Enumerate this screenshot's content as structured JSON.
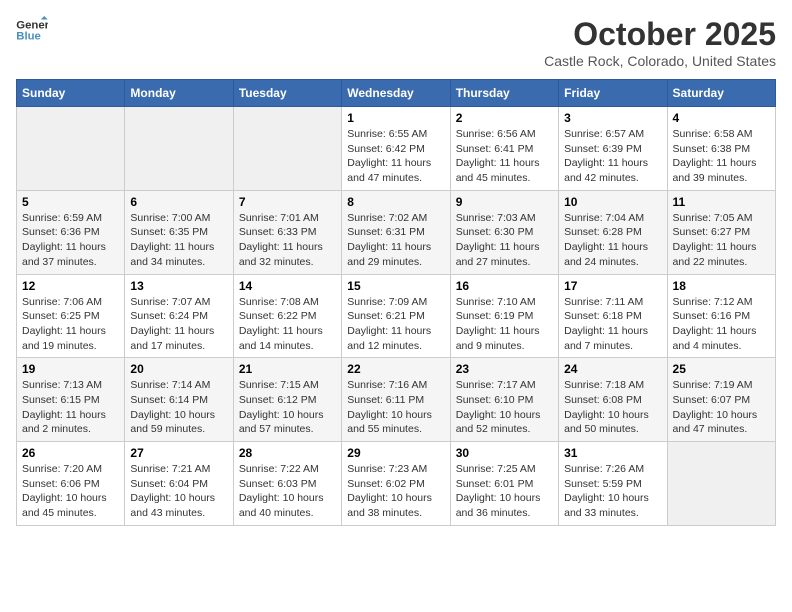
{
  "header": {
    "logo_line1": "General",
    "logo_line2": "Blue",
    "month": "October 2025",
    "location": "Castle Rock, Colorado, United States"
  },
  "weekdays": [
    "Sunday",
    "Monday",
    "Tuesday",
    "Wednesday",
    "Thursday",
    "Friday",
    "Saturday"
  ],
  "weeks": [
    [
      {
        "num": "",
        "info": ""
      },
      {
        "num": "",
        "info": ""
      },
      {
        "num": "",
        "info": ""
      },
      {
        "num": "1",
        "info": "Sunrise: 6:55 AM\nSunset: 6:42 PM\nDaylight: 11 hours and 47 minutes."
      },
      {
        "num": "2",
        "info": "Sunrise: 6:56 AM\nSunset: 6:41 PM\nDaylight: 11 hours and 45 minutes."
      },
      {
        "num": "3",
        "info": "Sunrise: 6:57 AM\nSunset: 6:39 PM\nDaylight: 11 hours and 42 minutes."
      },
      {
        "num": "4",
        "info": "Sunrise: 6:58 AM\nSunset: 6:38 PM\nDaylight: 11 hours and 39 minutes."
      }
    ],
    [
      {
        "num": "5",
        "info": "Sunrise: 6:59 AM\nSunset: 6:36 PM\nDaylight: 11 hours and 37 minutes."
      },
      {
        "num": "6",
        "info": "Sunrise: 7:00 AM\nSunset: 6:35 PM\nDaylight: 11 hours and 34 minutes."
      },
      {
        "num": "7",
        "info": "Sunrise: 7:01 AM\nSunset: 6:33 PM\nDaylight: 11 hours and 32 minutes."
      },
      {
        "num": "8",
        "info": "Sunrise: 7:02 AM\nSunset: 6:31 PM\nDaylight: 11 hours and 29 minutes."
      },
      {
        "num": "9",
        "info": "Sunrise: 7:03 AM\nSunset: 6:30 PM\nDaylight: 11 hours and 27 minutes."
      },
      {
        "num": "10",
        "info": "Sunrise: 7:04 AM\nSunset: 6:28 PM\nDaylight: 11 hours and 24 minutes."
      },
      {
        "num": "11",
        "info": "Sunrise: 7:05 AM\nSunset: 6:27 PM\nDaylight: 11 hours and 22 minutes."
      }
    ],
    [
      {
        "num": "12",
        "info": "Sunrise: 7:06 AM\nSunset: 6:25 PM\nDaylight: 11 hours and 19 minutes."
      },
      {
        "num": "13",
        "info": "Sunrise: 7:07 AM\nSunset: 6:24 PM\nDaylight: 11 hours and 17 minutes."
      },
      {
        "num": "14",
        "info": "Sunrise: 7:08 AM\nSunset: 6:22 PM\nDaylight: 11 hours and 14 minutes."
      },
      {
        "num": "15",
        "info": "Sunrise: 7:09 AM\nSunset: 6:21 PM\nDaylight: 11 hours and 12 minutes."
      },
      {
        "num": "16",
        "info": "Sunrise: 7:10 AM\nSunset: 6:19 PM\nDaylight: 11 hours and 9 minutes."
      },
      {
        "num": "17",
        "info": "Sunrise: 7:11 AM\nSunset: 6:18 PM\nDaylight: 11 hours and 7 minutes."
      },
      {
        "num": "18",
        "info": "Sunrise: 7:12 AM\nSunset: 6:16 PM\nDaylight: 11 hours and 4 minutes."
      }
    ],
    [
      {
        "num": "19",
        "info": "Sunrise: 7:13 AM\nSunset: 6:15 PM\nDaylight: 11 hours and 2 minutes."
      },
      {
        "num": "20",
        "info": "Sunrise: 7:14 AM\nSunset: 6:14 PM\nDaylight: 10 hours and 59 minutes."
      },
      {
        "num": "21",
        "info": "Sunrise: 7:15 AM\nSunset: 6:12 PM\nDaylight: 10 hours and 57 minutes."
      },
      {
        "num": "22",
        "info": "Sunrise: 7:16 AM\nSunset: 6:11 PM\nDaylight: 10 hours and 55 minutes."
      },
      {
        "num": "23",
        "info": "Sunrise: 7:17 AM\nSunset: 6:10 PM\nDaylight: 10 hours and 52 minutes."
      },
      {
        "num": "24",
        "info": "Sunrise: 7:18 AM\nSunset: 6:08 PM\nDaylight: 10 hours and 50 minutes."
      },
      {
        "num": "25",
        "info": "Sunrise: 7:19 AM\nSunset: 6:07 PM\nDaylight: 10 hours and 47 minutes."
      }
    ],
    [
      {
        "num": "26",
        "info": "Sunrise: 7:20 AM\nSunset: 6:06 PM\nDaylight: 10 hours and 45 minutes."
      },
      {
        "num": "27",
        "info": "Sunrise: 7:21 AM\nSunset: 6:04 PM\nDaylight: 10 hours and 43 minutes."
      },
      {
        "num": "28",
        "info": "Sunrise: 7:22 AM\nSunset: 6:03 PM\nDaylight: 10 hours and 40 minutes."
      },
      {
        "num": "29",
        "info": "Sunrise: 7:23 AM\nSunset: 6:02 PM\nDaylight: 10 hours and 38 minutes."
      },
      {
        "num": "30",
        "info": "Sunrise: 7:25 AM\nSunset: 6:01 PM\nDaylight: 10 hours and 36 minutes."
      },
      {
        "num": "31",
        "info": "Sunrise: 7:26 AM\nSunset: 5:59 PM\nDaylight: 10 hours and 33 minutes."
      },
      {
        "num": "",
        "info": ""
      }
    ]
  ]
}
